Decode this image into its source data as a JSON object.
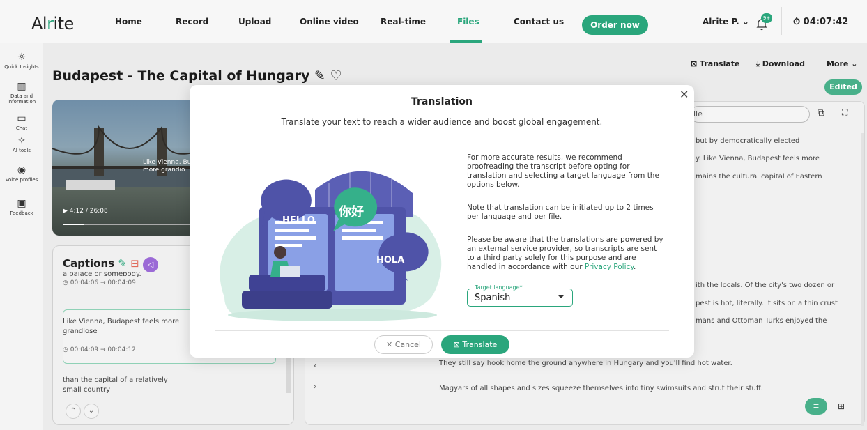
{
  "brand": {
    "logo_pre": "Al",
    "logo_accent": "r",
    "logo_post": "ite",
    "accent_color": "#2aa67c"
  },
  "nav": {
    "items": [
      "Home",
      "Record",
      "Upload",
      "Online video",
      "Real-time",
      "Files",
      "Contact us"
    ],
    "active": "Files",
    "order_label": "Order now",
    "user_label": "Alrite P. ⌄",
    "notif_count": "9+",
    "timer": "04:07:42"
  },
  "sidebar": {
    "items": [
      {
        "label": "Quick Insights",
        "icon": "bulb-icon"
      },
      {
        "label": "Data and information",
        "icon": "chart-icon"
      },
      {
        "label": "Chat",
        "icon": "chat-icon"
      },
      {
        "label": "AI tools",
        "icon": "ai-icon"
      },
      {
        "label": "Voice profiles",
        "icon": "voice-icon"
      },
      {
        "label": "Feedback",
        "icon": "feedback-icon"
      }
    ]
  },
  "file": {
    "title": "Budapest - The Capital of Hungary",
    "video_caption_l1": "Like Vienna, Budap",
    "video_caption_l2": "more grandio",
    "video_time": "4:12 / 26:08",
    "video_progress": 0.16
  },
  "toolbar_right": {
    "translate": "Translate",
    "download": "Download",
    "more": "More ⌄",
    "edited": "Edited"
  },
  "captions": {
    "title": "Captions",
    "items": [
      {
        "text": "a palace or somebody.",
        "time": "00:04:06 → 00:04:09"
      },
      {
        "text": "Like Vienna, Budapest feels more grandiose",
        "time": "00:04:09 → 00:04:12"
      },
      {
        "text": "than the capital of a relatively small country",
        "time": ""
      }
    ]
  },
  "transcript": {
    "search_fragment": "ile",
    "lines_top": [
      "but by democratically elected",
      "y. Like Vienna, Budapest feels more",
      "mains the cultural capital of Eastern"
    ],
    "lines_mid": [
      "ith the locals. Of the city's two dozen or",
      "pest is hot, literally. It sits on a thin crust",
      "mans and Ottoman Turks enjoyed the"
    ],
    "lines_bottom": [
      "They still say hook home the ground anywhere in Hungary and you'll find hot water.",
      "Magyars of all shapes and sizes squeeze themselves into tiny swimsuits and strut their stuff."
    ]
  },
  "modal": {
    "title": "Translation",
    "subtitle": "Translate your text to reach a wider audience and boost global engagement.",
    "para1": "For more accurate results, we recommend proofreading the transcript before opting for translation and selecting a target language from the options below.",
    "para2": "Note that translation can be initiated up to 2 times per language and per file.",
    "para3_pre": "Please be aware that the translations are powered by an external service provider, so transcripts are sent to a third party solely for this purpose and are handled in accordance with our ",
    "para3_link": "Privacy Policy",
    "para3_post": ".",
    "lang_label": "Target language*",
    "lang_value": "Spanish",
    "cancel": "Cancel",
    "translate": "Translate",
    "illustration": {
      "hello": "HELLO",
      "chinese": "你好",
      "hola": "HOLA"
    }
  }
}
